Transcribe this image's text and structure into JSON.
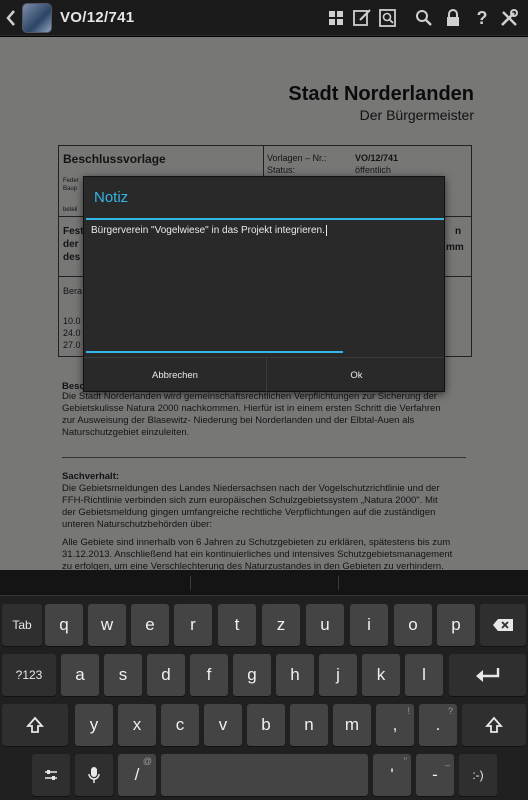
{
  "actionbar": {
    "title": "VO/12/741",
    "icons": [
      "back-icon",
      "app-logo",
      "grid-icon",
      "edit-note-icon",
      "search-page-icon",
      "search-icon",
      "lock-icon",
      "help-icon",
      "tools-icon"
    ],
    "help_glyph": "?"
  },
  "document": {
    "city": "Stadt Norderlanden",
    "mayor": "Der Bürgermeister",
    "table": {
      "heading": "Beschlussvorlage",
      "frag_fede": "Feder",
      "frag_baup": "Baup",
      "frag_betei": "beteil",
      "vorlagen_label": "Vorlagen – Nr.:",
      "vorlagen_value": "VO/12/741",
      "status_label": "Status:",
      "status_value": "öffentlich",
      "frag_fest": "Fest",
      "frag_der": "der",
      "frag_des": "des",
      "frag_n": "n",
      "frag_mm": "mm",
      "frag_bera": "Bera",
      "frag_d1": "10.0",
      "frag_d2": "24.0",
      "frag_d3": "27.0"
    },
    "frag_besc": "Besc",
    "para1_line1": "Die Stadt Norderlanden wird gemeinschaftsrechtlichen Verpflichtungen zur Sicherung der",
    "para1_line2": "Gebietskulisse Natura 2000 nachkommen. Hierfür ist in einem ersten Schritt die Verfahren",
    "para1_line3": "zur Ausweisung der Blasewitz- Niederung bei Norderlanden und der Elbtal-Auen als",
    "para1_line4": "Naturschutzgebiet einzuleiten.",
    "sachverhalt_heading": "Sachverhalt:",
    "para2_line1": "Die Gebietsmeldungen des Landes Niedersachsen nach der Vogelschutzrichtlinie und der",
    "para2_line2": "FFH-Richtlinie verbinden sich zum europäischen Schulzgebietssystem „Natura 2000\". Mit",
    "para2_line3": "der Gebietsmeldung gingen umfangreiche rechtliche Verpflichtungen auf die zuständigen",
    "para2_line4": "unteren Naturschutzbehörden über:",
    "para3_line1": "Alle Gebiete sind innerhalb von 6 Jahren zu Schutzgebieten zu erklären, spätestens bis zum",
    "para3_line2": "31.12.2013. Anschließend hat ein kontinuierliches und intensives Schutzgebietsmanagement",
    "para3_line3": "zu erfolgen, um eine Verschlechterung des Naturzustandes in den Gebieten zu verhindern."
  },
  "dialog": {
    "title": "Notiz",
    "text": "Bürgerverein \"Vogelwiese\" in das Projekt integrieren.",
    "cancel_label": "Abbrechen",
    "ok_label": "Ok"
  },
  "keyboard": {
    "tab": "Tab",
    "row1": [
      "q",
      "w",
      "e",
      "r",
      "t",
      "z",
      "u",
      "i",
      "o",
      "p"
    ],
    "symbols": "?123",
    "row2": [
      "a",
      "s",
      "d",
      "f",
      "g",
      "h",
      "j",
      "k",
      "l"
    ],
    "row3": [
      "y",
      "x",
      "c",
      "v",
      "b",
      "n",
      "m"
    ],
    "exclaim": "!",
    "question": "?",
    "comma": ",",
    "period": ".",
    "slash": "/",
    "at": "@",
    "apostrophe": "'",
    "quote": "\"",
    "dash": "-",
    "underscore": "_",
    "smiley": ":-)"
  }
}
